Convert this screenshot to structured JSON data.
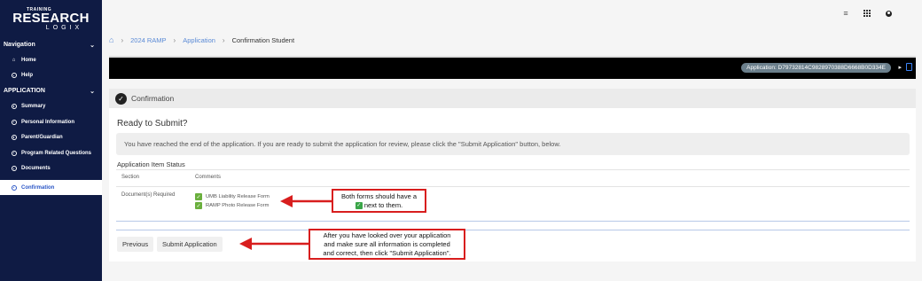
{
  "logo": {
    "top": "TRAINING",
    "main": "RESEARCH",
    "sub": "LOGIX"
  },
  "sidebar": {
    "nav_header": "Navigation",
    "nav_items": [
      {
        "label": "Home",
        "icon": "home-icon"
      },
      {
        "label": "Help",
        "icon": "help-icon"
      }
    ],
    "app_header": "APPLICATION",
    "app_items": [
      {
        "label": "Summary"
      },
      {
        "label": "Personal Information"
      },
      {
        "label": "Parent/Guardian"
      },
      {
        "label": "Program Related Questions"
      },
      {
        "label": "Documents"
      },
      {
        "label": "Confirmation",
        "active": true
      }
    ]
  },
  "breadcrumb": {
    "items": [
      {
        "label": "2024 RAMP",
        "link": true
      },
      {
        "label": "Application",
        "link": true
      },
      {
        "label": "Confirmation Student",
        "link": false
      }
    ]
  },
  "banner": {
    "application_id": "Application: D79732814C9828970388D6668B0D334E"
  },
  "card": {
    "header": "Confirmation",
    "title": "Ready to Submit?",
    "info": "You have reached the end of the application. If you are ready to submit the application for review, please click the \"Submit Application\" button, below.",
    "status_title": "Application Item Status",
    "columns": {
      "section": "Section",
      "comments": "Comments"
    },
    "row": {
      "section": "Document(s) Required",
      "comments": [
        "UMB Liability Release Form",
        "RAMP Photo Release Form"
      ]
    },
    "buttons": {
      "previous": "Previous",
      "submit": "Submit Application"
    }
  },
  "annotations": {
    "forms_line1": "Both forms should have a",
    "forms_line2": "next to them.",
    "submit_line1": "After you have looked over your application",
    "submit_line2": "and make sure all information is completed",
    "submit_line3": "and correct, then click \"Submit Application\"."
  },
  "colors": {
    "sidebar": "#0f1b44",
    "active_link": "#2a56c6",
    "annotation": "#d81e1e",
    "check": "#6aaf3d"
  }
}
